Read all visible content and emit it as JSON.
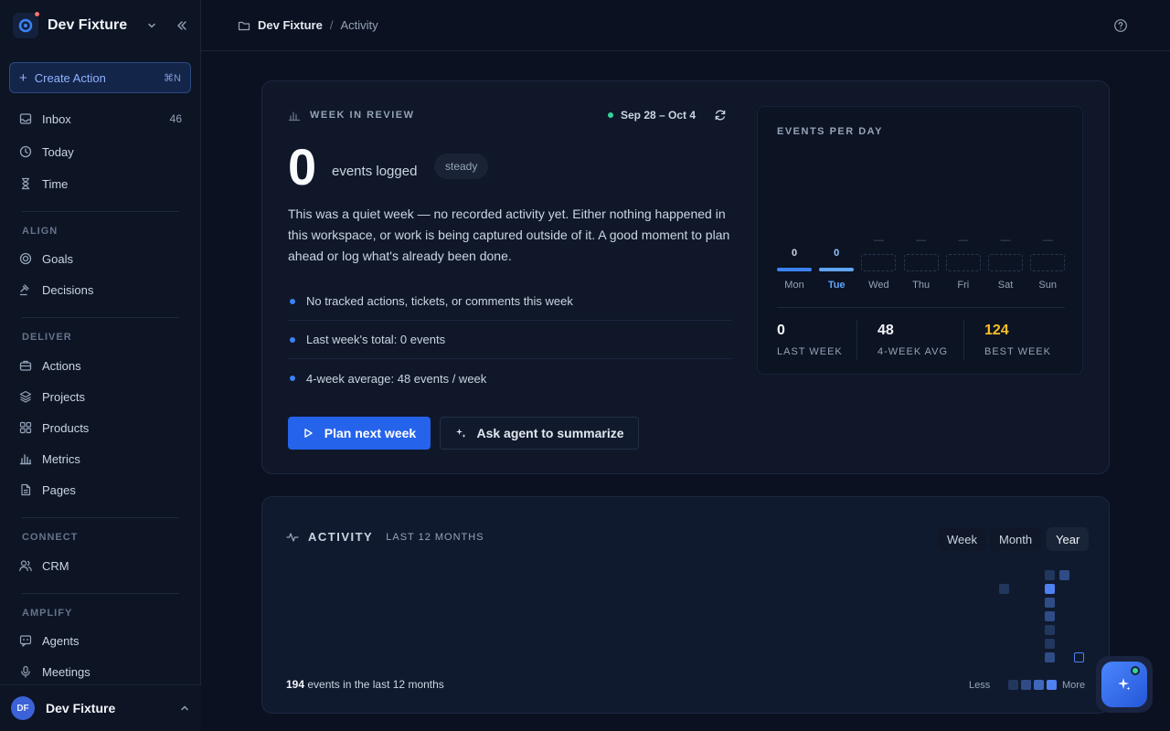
{
  "workspace": {
    "name": "Dev Fixture",
    "user_name": "Dev Fixture",
    "user_initials": "DF"
  },
  "sidebar": {
    "create_label": "Create Action",
    "create_shortcut": "⌘N",
    "items_top": [
      {
        "label": "Inbox",
        "icon": "inbox-icon",
        "count": "46"
      },
      {
        "label": "Today",
        "icon": "clock-icon"
      },
      {
        "label": "Time",
        "icon": "hourglass-icon"
      }
    ],
    "sections": [
      {
        "title": "ALIGN",
        "items": [
          {
            "label": "Goals",
            "icon": "target-icon"
          },
          {
            "label": "Decisions",
            "icon": "gavel-icon"
          }
        ]
      },
      {
        "title": "DELIVER",
        "items": [
          {
            "label": "Actions",
            "icon": "briefcase-icon"
          },
          {
            "label": "Projects",
            "icon": "layers-icon"
          },
          {
            "label": "Products",
            "icon": "grid-icon"
          },
          {
            "label": "Metrics",
            "icon": "bar-chart-icon"
          },
          {
            "label": "Pages",
            "icon": "document-icon"
          }
        ]
      },
      {
        "title": "CONNECT",
        "items": [
          {
            "label": "CRM",
            "icon": "users-icon"
          }
        ]
      },
      {
        "title": "AMPLIFY",
        "items": [
          {
            "label": "Agents",
            "icon": "chat-bot-icon"
          },
          {
            "label": "Meetings",
            "icon": "microphone-icon"
          }
        ]
      }
    ]
  },
  "breadcrumb": {
    "root": "Dev Fixture",
    "separator": "/",
    "current": "Activity"
  },
  "week_review": {
    "heading": "WEEK IN REVIEW",
    "date_range": "Sep 28 – Oct 4",
    "count": "0",
    "count_label": "events logged",
    "trend_badge": "steady",
    "description": "This was a quiet week — no recorded activity yet. Either nothing happened in this workspace, or work is being captured outside of it. A good moment to plan ahead or log what's already been done.",
    "bullets": [
      "No tracked actions, tickets, or comments this week",
      "Last week's total: 0 events",
      "4-week average: 48 events / week"
    ],
    "primary_button": "Plan next week",
    "secondary_button": "Ask agent to summarize"
  },
  "events_per_day": {
    "title": "EVENTS PER DAY",
    "days": [
      {
        "label": "Mon",
        "value": "0",
        "recorded": true,
        "active": false
      },
      {
        "label": "Tue",
        "value": "0",
        "recorded": true,
        "active": true
      },
      {
        "label": "Wed",
        "value": "—",
        "recorded": false,
        "active": false
      },
      {
        "label": "Thu",
        "value": "—",
        "recorded": false,
        "active": false
      },
      {
        "label": "Fri",
        "value": "—",
        "recorded": false,
        "active": false
      },
      {
        "label": "Sat",
        "value": "—",
        "recorded": false,
        "active": false
      },
      {
        "label": "Sun",
        "value": "—",
        "recorded": false,
        "active": false
      }
    ],
    "stats": [
      {
        "value": "0",
        "label": "LAST WEEK"
      },
      {
        "value": "48",
        "label": "4-WEEK AVG"
      },
      {
        "value": "124",
        "label": "BEST WEEK",
        "highlight": "#fbbf24"
      }
    ]
  },
  "activity": {
    "title": "ACTIVITY",
    "subtitle": "LAST 12 MONTHS",
    "ranges": [
      "Week",
      "Month",
      "Year"
    ],
    "selected_range": "Year",
    "total": "194",
    "total_suffix": "events in the last 12 months",
    "legend_less": "Less",
    "legend_more": "More"
  },
  "colors": {
    "accent": "#2563eb",
    "accent_light": "#60a5fa",
    "success": "#34d399",
    "highlight": "#fbbf24",
    "background": "#0b1120"
  }
}
